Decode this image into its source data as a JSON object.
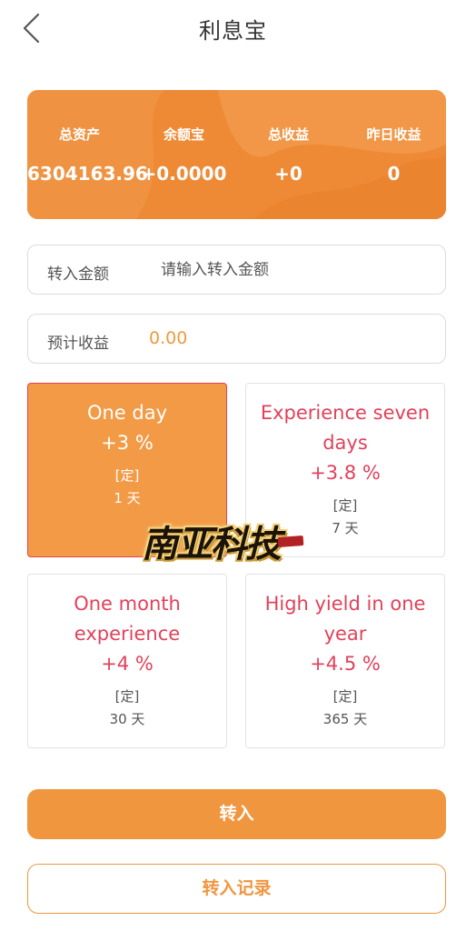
{
  "header": {
    "title": "利息宝",
    "back_icon": "chevron-left-icon"
  },
  "summary": {
    "stats": [
      {
        "label": "总资产",
        "value": "6304163.96"
      },
      {
        "label": "余额宝",
        "value": "+0.0000"
      },
      {
        "label": "总收益",
        "value": "+0"
      },
      {
        "label": "昨日收益",
        "value": "0"
      }
    ]
  },
  "form": {
    "amount_label": "转入金额",
    "amount_placeholder": "请输入转入金额",
    "estimate_label": "预计收益",
    "estimate_value": "0.00"
  },
  "plans": [
    {
      "name": "One day",
      "rate": "+3 %",
      "type": "[定]",
      "days": "1 天",
      "selected": true
    },
    {
      "name": "Experience seven days",
      "rate": "+3.8 %",
      "type": "[定]",
      "days": "7 天",
      "selected": false
    },
    {
      "name": "One month experience",
      "rate": "+4 %",
      "type": "[定]",
      "days": "30 天",
      "selected": false
    },
    {
      "name": "High yield in one year",
      "rate": "+4.5 %",
      "type": "[定]",
      "days": "365 天",
      "selected": false
    }
  ],
  "watermark": {
    "text": "南亚科技"
  },
  "buttons": {
    "transfer_in": "转入",
    "transfer_records": "转入记录"
  },
  "colors": {
    "accent": "#f0963f",
    "card": "#ee8a35",
    "plan_text": "#e2415a",
    "selected_border": "#e8414f"
  }
}
